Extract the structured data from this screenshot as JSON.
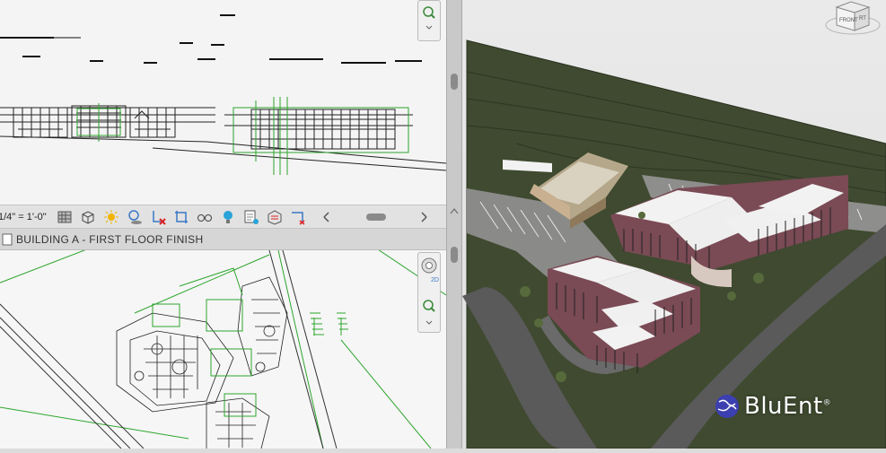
{
  "elevation_view": {
    "scale_label": "1/4\" = 1'-0\"",
    "toolbar_icons": [
      "detail-level-icon",
      "visual-style-icon",
      "sun-path-icon",
      "shadows-icon",
      "crop-view-icon",
      "show-crop-icon",
      "temporary-hide-icon",
      "reveal-hidden-icon",
      "lightbulb-icon",
      "worksharing-icon",
      "analytical-model-icon",
      "highlight-displacement-icon"
    ]
  },
  "plan_view": {
    "title": "BUILDING A - FIRST FLOOR FINISH",
    "nav_label": "2D"
  },
  "view3d": {
    "viewcube_label": "FRONT",
    "viewcube_side": "RT"
  },
  "brand": {
    "name": "BluEnt",
    "mark": "®"
  },
  "colors": {
    "terrain": "#3f4a30",
    "road": "#5a5a5a",
    "cad_green": "#2da52d",
    "building_roof": "#f2f2f2",
    "building_wall": "#7a4a55"
  }
}
